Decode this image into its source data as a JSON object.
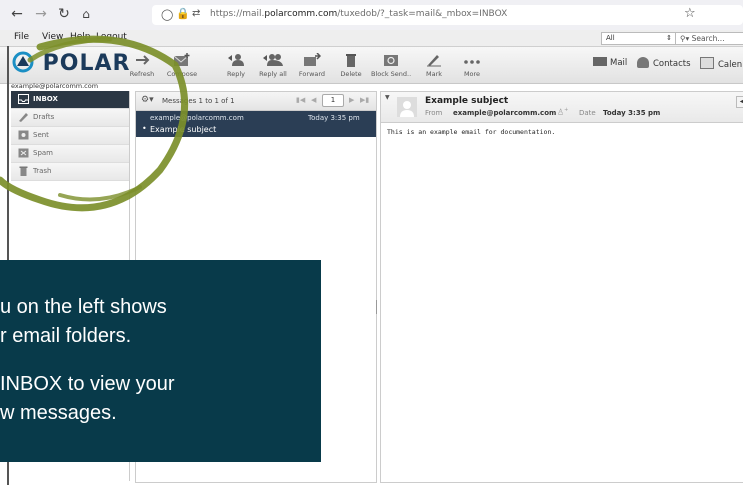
{
  "browser": {
    "url_prefix": "https://mail.",
    "url_domain": "polarcomm.com",
    "url_path": "/tuxedob/?_task=mail&_mbox=INBOX"
  },
  "menubar": {
    "items": [
      "File",
      "View",
      "Help",
      "Logout"
    ],
    "scope_value": "All",
    "search_placeholder": "Search..."
  },
  "logo_text": "POLAR",
  "toolbar": {
    "refresh": "Refresh",
    "compose": "Compose",
    "reply": "Reply",
    "reply_all": "Reply all",
    "forward": "Forward",
    "delete": "Delete",
    "block_sender": "Block Send..",
    "mark": "Mark",
    "more": "More"
  },
  "app_tabs": {
    "mail": "Mail",
    "contacts": "Contacts",
    "calendar": "Calen"
  },
  "account": "example@polarcomm.com",
  "folders": [
    "INBOX",
    "Drafts",
    "Sent",
    "Spam",
    "Trash"
  ],
  "message_list": {
    "count_text": "Messages 1 to 1 of 1",
    "page_number": "1",
    "messages": [
      {
        "from": "example@polarcomm.com",
        "date": "Today 3:35 pm",
        "subject": "Example subject"
      }
    ]
  },
  "preview": {
    "subject": "Example subject",
    "from_label": "From",
    "from": "example@polarcomm.com",
    "date_label": "Date",
    "date": "Today 3:35 pm",
    "body": "This is an example email for documentation."
  },
  "overlay": {
    "line1": "u on the left shows",
    "line2": "r email folders.",
    "line3": "INBOX to view your",
    "line4": "w messages."
  },
  "colors": {
    "overlay_bg": "#083a4a",
    "highlight_circle": "#7c8f2a",
    "selected_row": "#2b3e55",
    "logo": "#1b3a5b"
  }
}
